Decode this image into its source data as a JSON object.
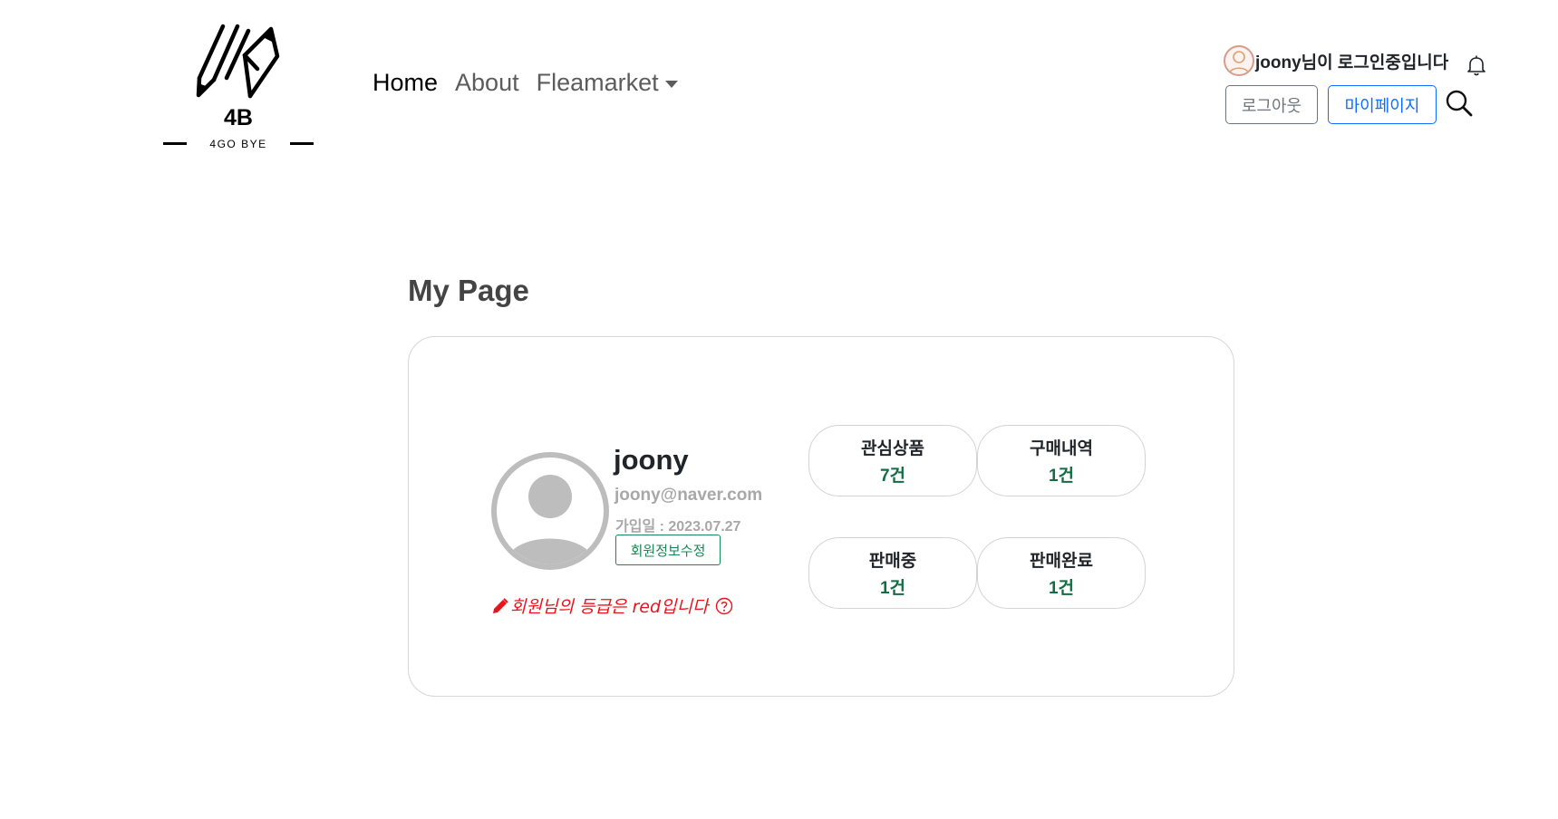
{
  "header": {
    "logo": {
      "title": "4B",
      "subtitle": "4GO BYE"
    },
    "nav": {
      "home": "Home",
      "about": "About",
      "fleamarket": "Fleamarket"
    },
    "user": {
      "status_text": "joony님이 로그인중입니다",
      "logout_label": "로그아웃",
      "mypage_label": "마이페이지",
      "icons": {
        "avatar": "user-avatar-icon",
        "bell": "bell-icon",
        "search": "search-icon"
      }
    }
  },
  "main": {
    "page_title": "My Page",
    "profile": {
      "username": "joony",
      "email": "joony@naver.com",
      "joined": "가입일 : 2023.07.27",
      "edit_label": "회원정보수정",
      "grade_text": "회원님의 등급은 red입니다",
      "grade_color": "#e8141c"
    },
    "stats": [
      {
        "label": "관심상품",
        "count": "7건"
      },
      {
        "label": "구매내역",
        "count": "1건"
      },
      {
        "label": "판매중",
        "count": "1건"
      },
      {
        "label": "판매완료",
        "count": "1건"
      }
    ]
  },
  "colors": {
    "primary": "#0d6efd",
    "secondary": "#6c757d",
    "success": "#198754",
    "count_green": "#146c43",
    "danger": "#e8141c"
  }
}
